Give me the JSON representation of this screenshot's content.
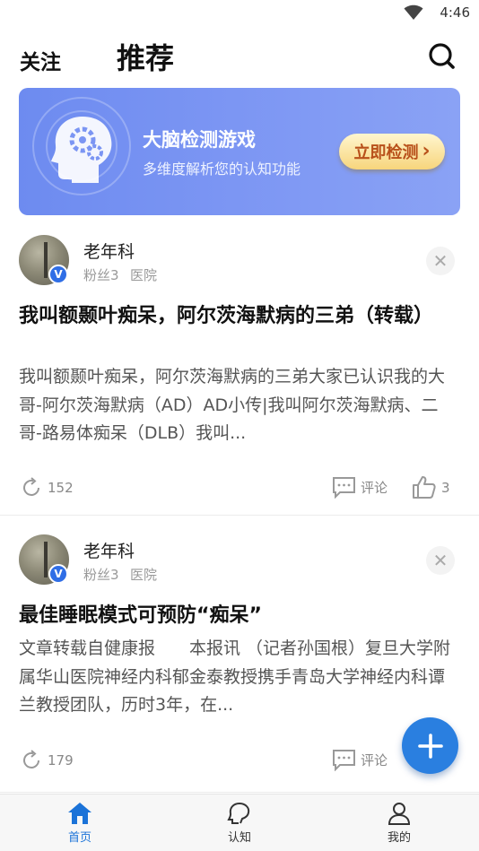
{
  "status_bar": {
    "time": "4:46",
    "wifi_icon": "wifi-icon"
  },
  "header": {
    "tabs": [
      {
        "label": "关注",
        "active": false
      },
      {
        "label": "推荐",
        "active": true
      }
    ],
    "search_icon": "search-icon"
  },
  "banner": {
    "title": "大脑检测游戏",
    "subtitle": "多维度解析您的认知功能",
    "cta_label": "立即检测",
    "cta_arrow": "›",
    "icon": "brain-gear-icon"
  },
  "posts": [
    {
      "author": "老年科",
      "fans_label": "粉丝3",
      "category": "医院",
      "verified_badge": "V",
      "title": "我叫额颞叶痴呆，阿尔茨海默病的三弟（转载）",
      "body": "我叫额颞叶痴呆，阿尔茨海默病的三弟大家已认识我的大哥-阿尔茨海默病（AD）AD小传|我叫阿尔茨海默病、二哥-路易体痴呆（DLB）我叫...",
      "views": "152",
      "comment_label": "评论",
      "likes": "3"
    },
    {
      "author": "老年科",
      "fans_label": "粉丝3",
      "category": "医院",
      "verified_badge": "V",
      "title": "最佳睡眠模式可预防“痴呆”",
      "body": "文章转载自健康报　　本报讯 （记者孙国根）复旦大学附属华山医院神经内科郁金泰教授携手青岛大学神经内科谭兰教授团队，历时3年，在...",
      "views": "179",
      "comment_label": "评论",
      "likes": ""
    }
  ],
  "fab": {
    "icon": "plus-icon"
  },
  "bottom_nav": [
    {
      "label": "首页",
      "icon": "home-icon",
      "active": true
    },
    {
      "label": "认知",
      "icon": "head-outline-icon",
      "active": false
    },
    {
      "label": "我的",
      "icon": "person-icon",
      "active": false
    }
  ],
  "colors": {
    "accent": "#2a7fe0",
    "banner": "#7b95f3",
    "cta_text": "#b8501a"
  }
}
